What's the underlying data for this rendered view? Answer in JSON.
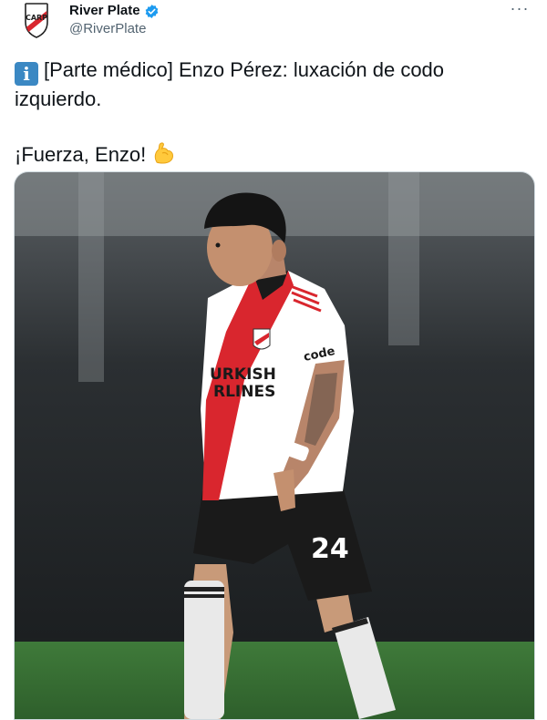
{
  "account": {
    "display_name": "River Plate",
    "handle": "@RiverPlate",
    "verified": true,
    "avatar_icon": "river-plate-crest-icon"
  },
  "menu": {
    "more_label": "···"
  },
  "tweet": {
    "line1": "[Parte médico] Enzo Pérez: luxación de codo",
    "line2": "izquierdo.",
    "line3": "¡Fuerza, Enzo!",
    "info_icon": "information-emoji-icon",
    "flex_icon": "flexed-biceps-emoji-icon"
  },
  "media": {
    "sponsor_line1": "URKISH",
    "sponsor_line2": "RLINES",
    "sleeve_brand": "code",
    "shorts_number": "24"
  },
  "colors": {
    "text": "#0f1419",
    "secondary": "#536471",
    "verified": "#1d9bf0",
    "river_red": "#d9262e"
  }
}
